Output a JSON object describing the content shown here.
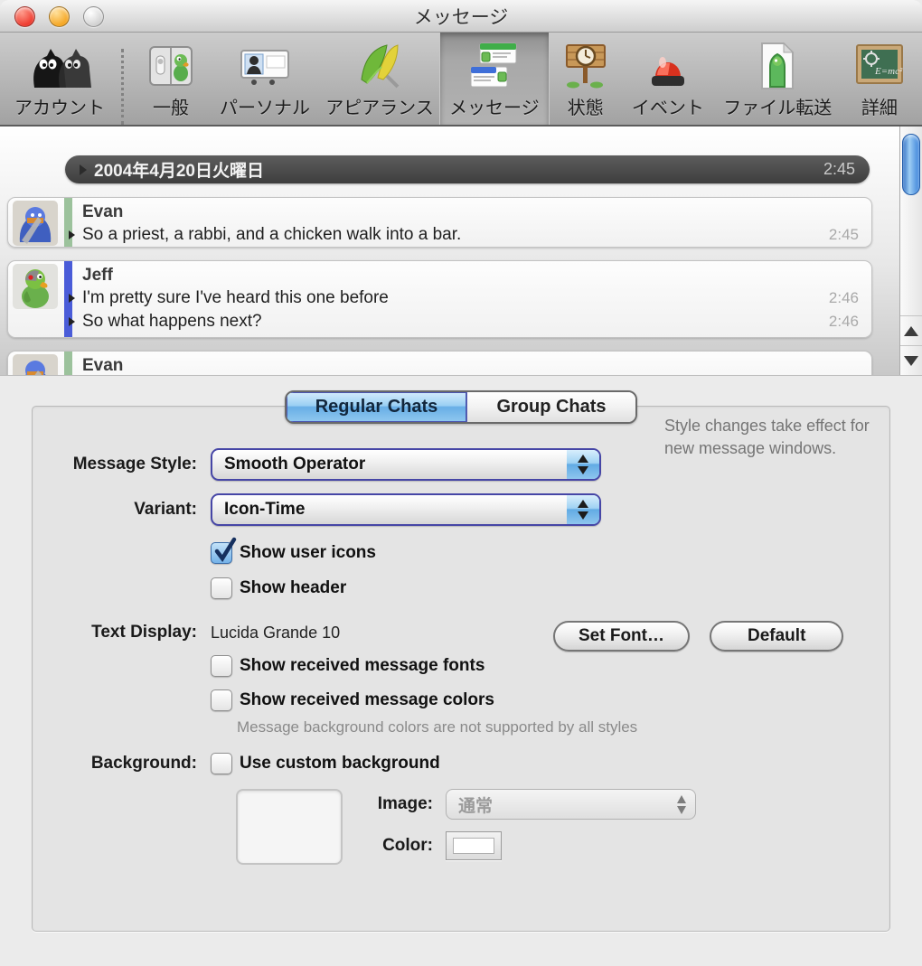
{
  "window": {
    "title": "メッセージ"
  },
  "toolbar": {
    "items": [
      {
        "label": "アカウント",
        "icon": "accounts-ducks-icon",
        "selected": false
      },
      {
        "label": "一般",
        "icon": "general-prefs-icon",
        "selected": false
      },
      {
        "label": "パーソナル",
        "icon": "personal-card-icon",
        "selected": false
      },
      {
        "label": "アピアランス",
        "icon": "appearance-feathers-icon",
        "selected": false
      },
      {
        "label": "メッセージ",
        "icon": "messages-chat-icon",
        "selected": true
      },
      {
        "label": "状態",
        "icon": "status-sign-icon",
        "selected": false
      },
      {
        "label": "イベント",
        "icon": "events-siren-icon",
        "selected": false
      },
      {
        "label": "ファイル転送",
        "icon": "file-transfer-duck-icon",
        "selected": false
      },
      {
        "label": "詳細",
        "icon": "advanced-chalkboard-icon",
        "selected": false
      }
    ]
  },
  "preview": {
    "date_header": {
      "text": "2004年4月20日火曜日",
      "time": "2:45"
    },
    "messages": [
      {
        "sender": "Evan",
        "lines": [
          {
            "text": "So a priest, a rabbi, and a chicken walk into a bar.",
            "time": "2:45"
          }
        ]
      },
      {
        "sender": "Jeff",
        "lines": [
          {
            "text": "I'm pretty sure I've heard this one before",
            "time": "2:46"
          },
          {
            "text": "So what happens next?",
            "time": "2:46"
          }
        ]
      },
      {
        "sender": "Evan",
        "lines": []
      }
    ]
  },
  "settings": {
    "tabs": [
      {
        "label": "Regular Chats",
        "selected": true
      },
      {
        "label": "Group Chats",
        "selected": false
      }
    ],
    "side_note": "Style changes take effect for new message windows.",
    "message_style": {
      "label": "Message Style:",
      "value": "Smooth Operator"
    },
    "variant": {
      "label": "Variant:",
      "value": "Icon-Time"
    },
    "show_user_icons": {
      "label": "Show user icons",
      "checked": true
    },
    "show_header": {
      "label": "Show header",
      "checked": false
    },
    "text_display": {
      "label": "Text Display:",
      "value": "Lucida Grande 10",
      "set_font_button": "Set Font…",
      "default_button": "Default"
    },
    "show_received_fonts": {
      "label": "Show received message fonts",
      "checked": false
    },
    "show_received_colors": {
      "label": "Show received message colors",
      "checked": false
    },
    "colors_note": "Message background colors are not supported by all styles",
    "background": {
      "label": "Background:",
      "use_custom": {
        "label": "Use custom background",
        "checked": false
      },
      "image_label": "Image:",
      "image_value": "通常",
      "color_label": "Color:"
    }
  },
  "colors": {
    "selected_tab_blue": "#68aee6",
    "checkbox_checked_blue": "#74b2e8",
    "scrollbar_thumb_blue": "#4a8ede",
    "evan_stripe_green": "#9cc29c",
    "jeff_stripe_blue": "#4a5cd8",
    "date_bar_gray": "#4a4a4a"
  }
}
